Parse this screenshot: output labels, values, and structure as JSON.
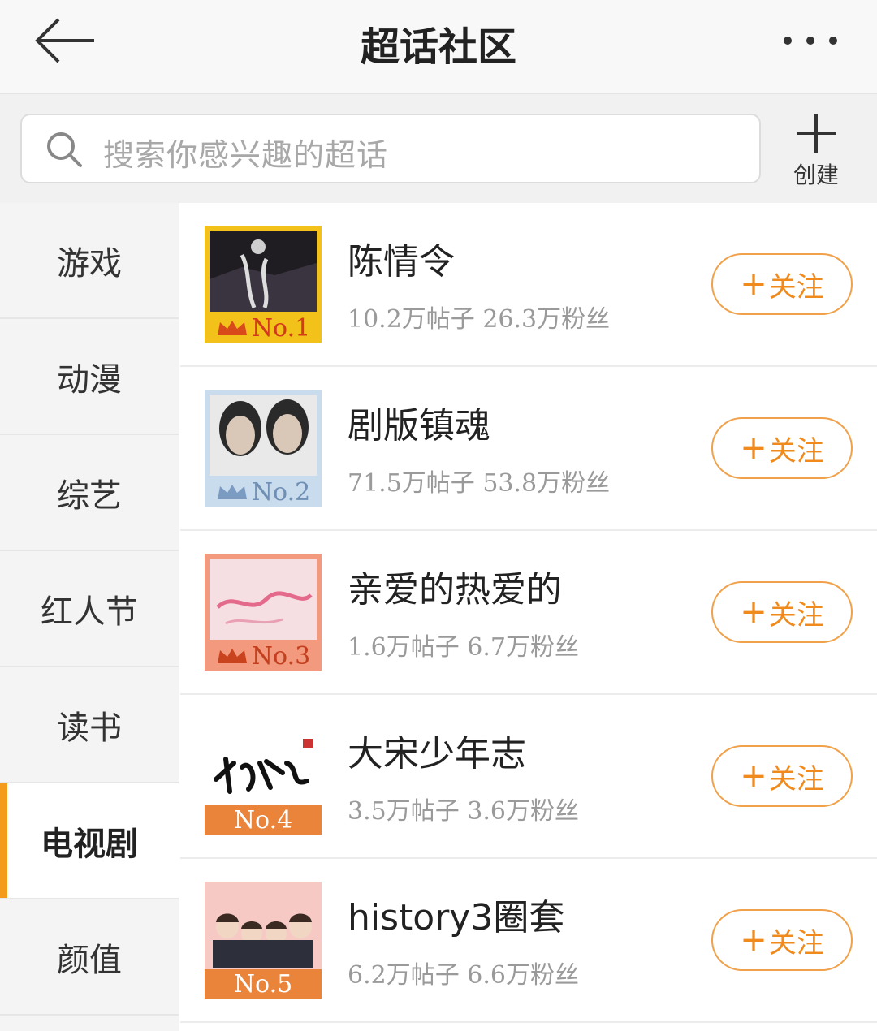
{
  "header": {
    "title": "超话社区"
  },
  "search": {
    "placeholder": "搜索你感兴趣的超话",
    "create_label": "创建"
  },
  "sidebar": {
    "items": [
      {
        "label": "游戏"
      },
      {
        "label": "动漫"
      },
      {
        "label": "综艺"
      },
      {
        "label": "红人节"
      },
      {
        "label": "读书"
      },
      {
        "label": "电视剧"
      },
      {
        "label": "颜值"
      }
    ],
    "active_index": 5
  },
  "topics": [
    {
      "rank": "No.1",
      "name": "陈情令",
      "stats": "10.2万帖子 26.3万粉丝",
      "follow_label": "关注",
      "badge_color": "#f2c21b"
    },
    {
      "rank": "No.2",
      "name": "剧版镇魂",
      "stats": "71.5万帖子 53.8万粉丝",
      "follow_label": "关注",
      "badge_color": "#c9dcee"
    },
    {
      "rank": "No.3",
      "name": "亲爱的热爱的",
      "stats": "1.6万帖子 6.7万粉丝",
      "follow_label": "关注",
      "badge_color": "#f39a7e"
    },
    {
      "rank": "No.4",
      "name": "大宋少年志",
      "stats": "3.5万帖子 3.6万粉丝",
      "follow_label": "关注",
      "badge_color": "#e9843a"
    },
    {
      "rank": "No.5",
      "name": "history3圈套",
      "stats": "6.2万帖子 6.6万粉丝",
      "follow_label": "关注",
      "badge_color": "#e9843a"
    }
  ],
  "colors": {
    "accent": "#f08a1c",
    "active_marker": "#f49b1c"
  }
}
